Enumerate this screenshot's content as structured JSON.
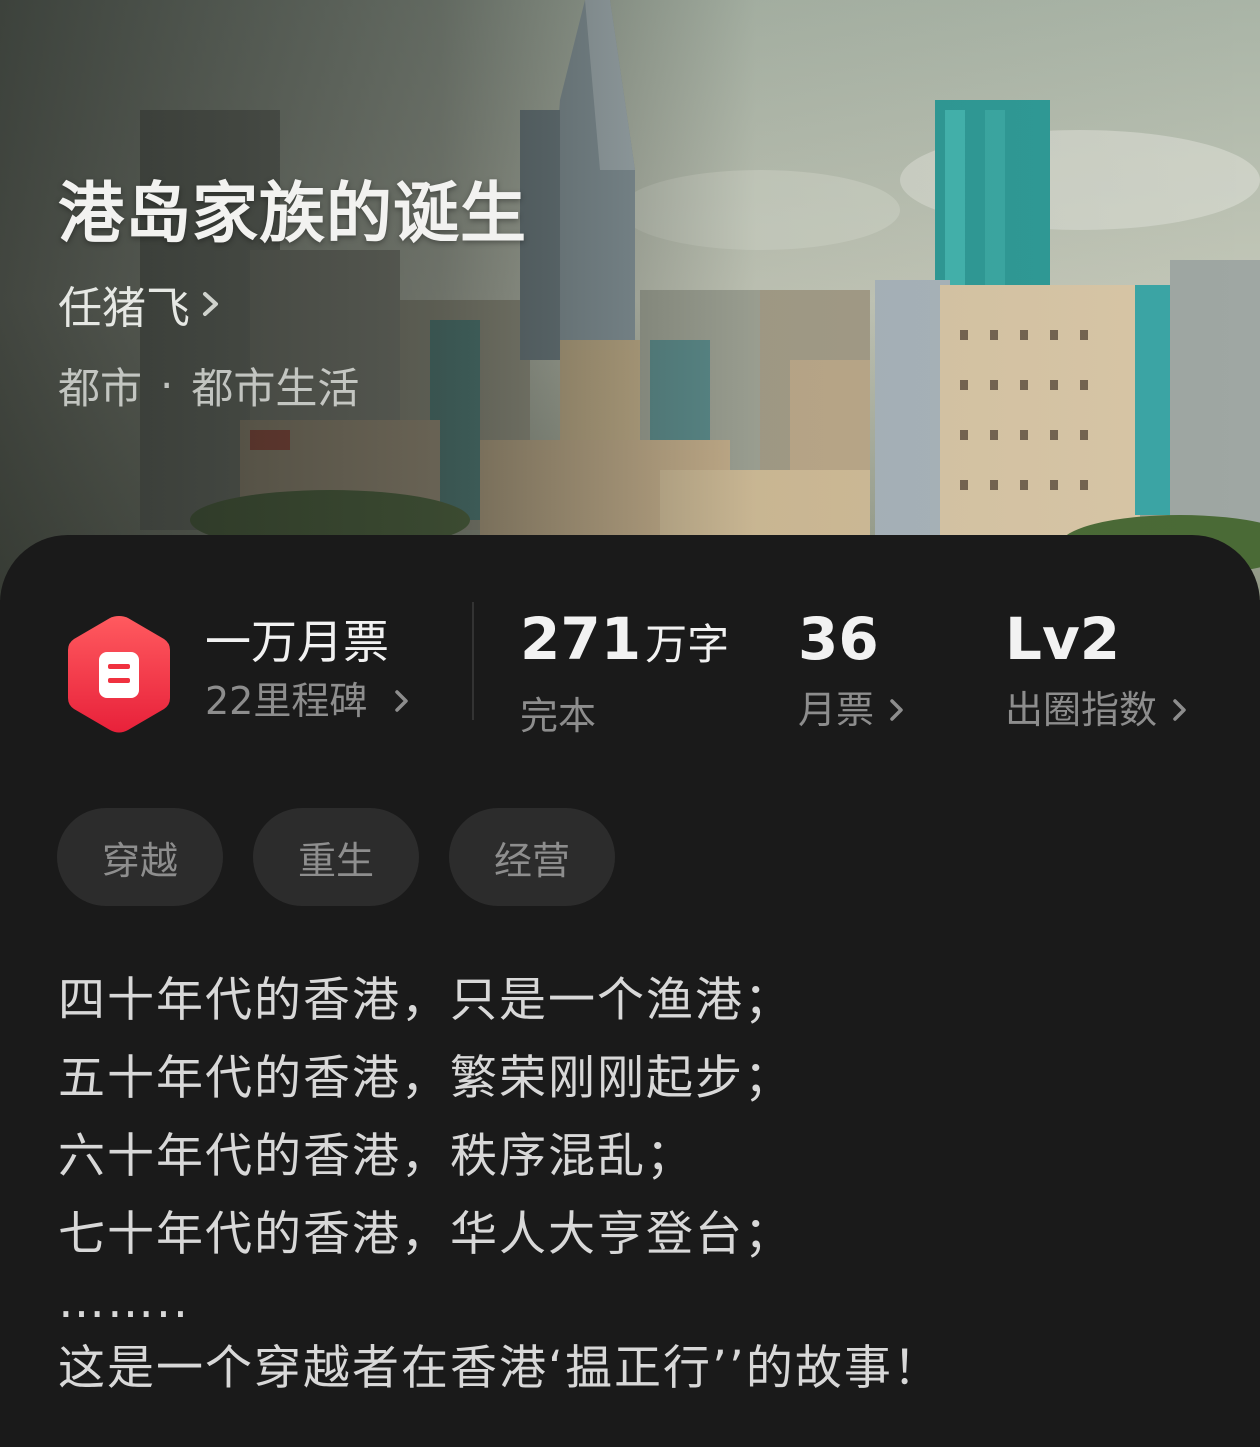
{
  "book": {
    "title": "港岛家族的诞生",
    "author": "任猪飞",
    "genre_main": "都市",
    "genre_separator": "·",
    "genre_sub": "都市生活"
  },
  "stats": {
    "monthly_ticket_tier": "一万月票",
    "milestones": "22里程碑",
    "word_count": "271",
    "word_count_unit": "万字",
    "status": "完本",
    "monthly_tickets": "36",
    "monthly_tickets_label": "月票",
    "level": "Lv2",
    "level_label": "出圈指数"
  },
  "tags": [
    "穿越",
    "重生",
    "经营"
  ],
  "description": [
    "四十年代的香港，只是一个渔港；",
    "五十年代的香港，繁荣刚刚起步；",
    "六十年代的香港，秩序混乱；",
    "七十年代的香港，华人大亨登台；",
    "……..",
    "这是一个穿越者在香港‘揾正行’’的故事！"
  ],
  "icons": {
    "badge": "ticket-badge-icon",
    "chevron": "chevron-right-icon"
  },
  "colors": {
    "badge_gradient_top": "#ff5a5f",
    "badge_gradient_bottom": "#e8213a",
    "panel_bg": "#1a1a1a",
    "tag_bg": "#2c2c2c"
  }
}
